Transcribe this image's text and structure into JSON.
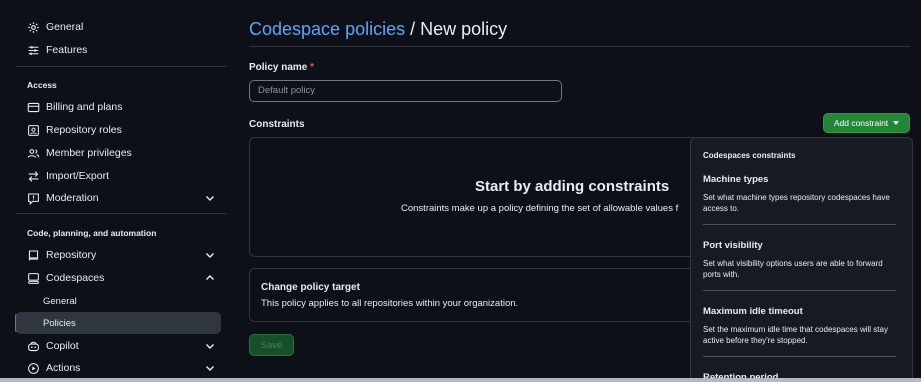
{
  "sidebar": {
    "top_items": [
      {
        "label": "General",
        "icon": "gear-icon"
      },
      {
        "label": "Features",
        "icon": "sliders-icon"
      }
    ],
    "access_title": "Access",
    "access_items": [
      {
        "label": "Billing and plans",
        "icon": "credit-card-icon"
      },
      {
        "label": "Repository roles",
        "icon": "repo-roles-icon"
      },
      {
        "label": "Member privileges",
        "icon": "people-icon"
      },
      {
        "label": "Import/Export",
        "icon": "arrow-switch-icon"
      },
      {
        "label": "Moderation",
        "icon": "report-icon"
      }
    ],
    "code_title": "Code, planning, and automation",
    "code_items": [
      {
        "label": "Repository",
        "icon": "repo-icon"
      },
      {
        "label": "Codespaces",
        "icon": "codespaces-icon"
      },
      {
        "label": "General"
      },
      {
        "label": "Policies"
      },
      {
        "label": "Copilot",
        "icon": "copilot-icon"
      },
      {
        "label": "Actions",
        "icon": "play-icon"
      }
    ]
  },
  "main": {
    "breadcrumb_link": "Codespace policies",
    "breadcrumb_sep": " / ",
    "page_title": "New policy",
    "policy_name_label": "Policy name",
    "required_mark": "*",
    "policy_name_placeholder": "Default policy",
    "constraints_label": "Constraints",
    "add_constraint_label": "Add constraint",
    "empty_title": "Start by adding constraints",
    "empty_desc": "Constraints make up a policy defining the set of allowable values f",
    "target_title": "Change policy target",
    "target_desc": "This policy applies to all repositories within your organization.",
    "save_label": "Save"
  },
  "dropdown": {
    "header": "Codespaces constraints",
    "items": [
      {
        "title": "Machine types",
        "desc": "Set what machine types repository codespaces have access to."
      },
      {
        "title": "Port visibility",
        "desc": "Set what visibility options users are able to forward ports with."
      },
      {
        "title": "Maximum idle timeout",
        "desc": "Set the maximum idle time that codespaces will stay active before they're stopped."
      },
      {
        "title": "Retention period",
        "desc": ""
      }
    ]
  },
  "colors": {
    "accent": "#58a6ff",
    "primary_button": "#238636",
    "background": "#0d1117",
    "required": "#f85149"
  }
}
